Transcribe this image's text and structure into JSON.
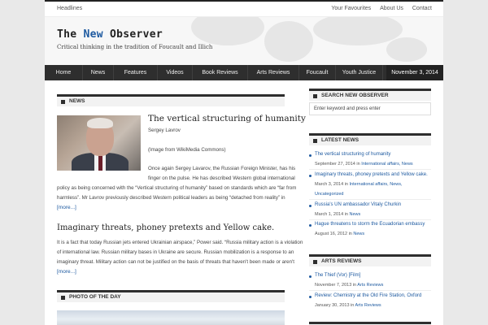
{
  "top_bar": {
    "left_link": "Headlines",
    "right_links": [
      "Your Favourites",
      "About Us",
      "Contact"
    ]
  },
  "header": {
    "title_part1": "The ",
    "title_accent": "New",
    "title_part2": " Observer",
    "tagline": "Critical thinking in the tradition of Foucault and Illich"
  },
  "nav": {
    "items": [
      "Home",
      "News",
      "Features",
      "Videos",
      "Book Reviews",
      "Arts Reviews",
      "Foucault",
      "Youth Justice"
    ],
    "date": "November 3, 2014"
  },
  "news": {
    "heading": "NEWS",
    "post1": {
      "title": "The vertical structuring of humanity",
      "lines": [
        "Sergey Lavrov",
        "(Image from WikiMedia Commons)",
        "Once again Sergey Lavarov, the Russian Foreign Minister, has his",
        "finger on the pulse. He has described Western global international",
        "policy as being concerned with the “Vertical structuring of humanity” based on standards which are “far from",
        "harmless”. Mr Lavrov previously described Western political leaders as being “detached from reality” in"
      ],
      "more": "[more...]"
    },
    "post2": {
      "title": "Imaginary threats, phoney pretexts and Yellow cake.",
      "lines": [
        "It is a fact that today Russian jets entered Ukrainian airspace,” Power said. “Russia military action is a violation",
        "of international law. Russian military bases in Ukraine are secure. Russian mobilization is a response to an",
        "imaginary threat. Military action can not be justified on the basis of threats that haven't been made or aren't"
      ],
      "more": "[more...]"
    }
  },
  "photo_of_day": {
    "heading": "PHOTO OF THE DAY"
  },
  "sidebar": {
    "search": {
      "heading": "SEARCH NEW OBSERVER",
      "value": "Enter keyword and press enter"
    },
    "latest": {
      "heading": "LATEST NEWS",
      "items": [
        {
          "title": "The vertical structuring of humanity",
          "meta": "September 27, 2014 in ",
          "cats": "International affairs, News"
        },
        {
          "title": "Imaginary threats, phoney pretexts and Yellow cake.",
          "meta": "March 3, 2014 in ",
          "cats": "International affairs, News,",
          "cats2": "Uncategorized"
        },
        {
          "title": "Russia's UN ambassador Vitaly Churkin",
          "meta": "March 1, 2014 in ",
          "cats": "News"
        },
        {
          "title": "Hague threatens to storm the Ecuadorian embassy",
          "meta": "August 16, 2012 in ",
          "cats": "News"
        }
      ]
    },
    "arts": {
      "heading": "ARTS REVIEWS",
      "items": [
        {
          "title": "The Thief (Vor) [Film]",
          "meta": "November 7, 2013 in ",
          "cats": "Arts Reviews"
        },
        {
          "title": "Review: Chemistry at the Old Fire Station, Oxford",
          "meta": "January 30, 2013 in ",
          "cats": "Arts Reviews"
        }
      ]
    }
  }
}
